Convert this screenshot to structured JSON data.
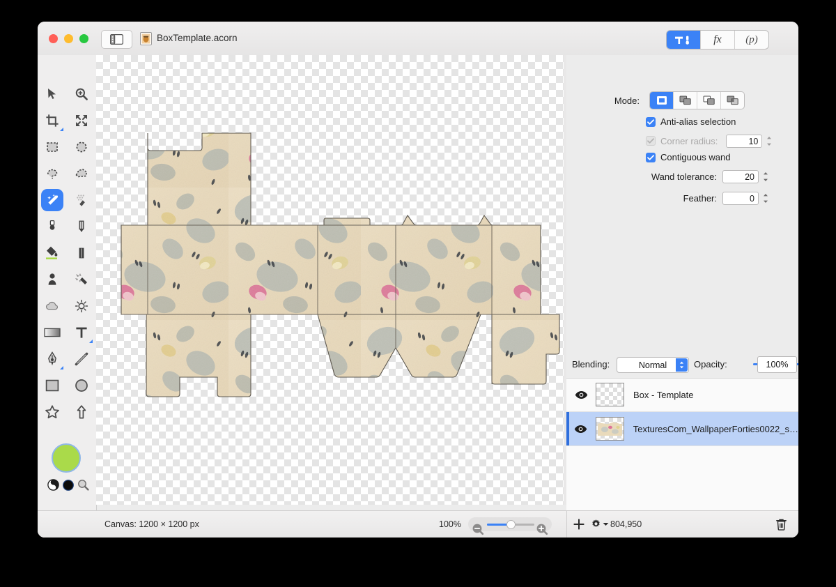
{
  "window": {
    "title": "BoxTemplate.acorn",
    "traffic_lights": [
      "close",
      "minimize",
      "zoom"
    ],
    "sidebar_toggle": "sidebar-toggle",
    "doc_icon": "acorn-document-icon"
  },
  "titlebar_segments": [
    {
      "id": "tools",
      "icon": "hammer-icon",
      "label": "",
      "active": true
    },
    {
      "id": "filters",
      "icon": "fx-icon",
      "label": "fx",
      "active": false
    },
    {
      "id": "presets",
      "icon": "palette-icon",
      "label": "(p)",
      "active": false
    }
  ],
  "tools": [
    {
      "name": "move-tool",
      "icon": "arrow-pointer-icon",
      "selected": false
    },
    {
      "name": "zoom-tool",
      "icon": "magnifier-plus-icon",
      "selected": false
    },
    {
      "name": "crop-tool",
      "icon": "crop-icon",
      "selected": false,
      "submenu": true
    },
    {
      "name": "transform-tool",
      "icon": "arrows-expand-icon",
      "selected": false
    },
    {
      "name": "rectangular-marquee-tool",
      "icon": "dashed-rectangle-icon",
      "selected": false
    },
    {
      "name": "elliptical-marquee-tool",
      "icon": "dashed-ellipse-icon",
      "selected": false
    },
    {
      "name": "lasso-tool",
      "icon": "lasso-icon",
      "selected": false
    },
    {
      "name": "polygon-lasso-tool",
      "icon": "polygon-lasso-icon",
      "selected": false
    },
    {
      "name": "magic-wand-tool",
      "icon": "magic-wand-icon",
      "selected": true
    },
    {
      "name": "instant-alpha-tool",
      "icon": "dotted-wand-icon",
      "selected": false
    },
    {
      "name": "brush-tool",
      "icon": "paintbrush-icon",
      "selected": false
    },
    {
      "name": "pencil-tool",
      "icon": "pencil-icon",
      "selected": false
    },
    {
      "name": "paint-bucket-tool",
      "icon": "paint-bucket-icon",
      "selected": false
    },
    {
      "name": "eraser-tool",
      "icon": "eraser-icon",
      "selected": false
    },
    {
      "name": "clone-stamp-tool",
      "icon": "clone-stamp-icon",
      "selected": false
    },
    {
      "name": "smudge-tool",
      "icon": "smudge-icon",
      "selected": false
    },
    {
      "name": "blur-tool",
      "icon": "cloud-icon",
      "selected": false
    },
    {
      "name": "dodge-tool",
      "icon": "sun-icon",
      "selected": false
    },
    {
      "name": "gradient-tool",
      "icon": "gradient-icon",
      "selected": false
    },
    {
      "name": "text-tool",
      "icon": "text-t-icon",
      "selected": false,
      "submenu": true
    },
    {
      "name": "bezier-pen-tool",
      "icon": "pen-nib-icon",
      "selected": false,
      "submenu": true
    },
    {
      "name": "line-tool",
      "icon": "line-icon",
      "selected": false
    },
    {
      "name": "rectangle-shape-tool",
      "icon": "rectangle-icon",
      "selected": false
    },
    {
      "name": "ellipse-shape-tool",
      "icon": "ellipse-icon",
      "selected": false
    },
    {
      "name": "star-shape-tool",
      "icon": "star-icon",
      "selected": false
    },
    {
      "name": "arrow-shape-tool",
      "icon": "arrow-up-icon",
      "selected": false
    }
  ],
  "palette": {
    "color_swatch": "#aada4a",
    "swatch_ring": "#8fb7e8",
    "mini_icons": [
      "contrast-half-circle-icon",
      "black-circle-icon",
      "magnifier-icon"
    ]
  },
  "inspector": {
    "mode_label": "Mode:",
    "mode_options": [
      {
        "name": "new-selection",
        "active": true
      },
      {
        "name": "add-to-selection",
        "active": false
      },
      {
        "name": "subtract-from-selection",
        "active": false
      },
      {
        "name": "intersect-selection",
        "active": false
      }
    ],
    "antialias": {
      "label": "Anti-alias selection",
      "checked": true,
      "enabled": true
    },
    "corner_radius": {
      "label": "Corner radius:",
      "checked": true,
      "enabled": false,
      "value": "10"
    },
    "contiguous": {
      "label": "Contiguous wand",
      "checked": true,
      "enabled": true
    },
    "wand_tolerance": {
      "label": "Wand tolerance:",
      "value": "20"
    },
    "feather": {
      "label": "Feather:",
      "value": "0"
    }
  },
  "layers_panel": {
    "blending_label": "Blending:",
    "blending_value": "Normal",
    "opacity_label": "Opacity:",
    "opacity_value": "100%",
    "opacity_percent": 100,
    "rows": [
      {
        "name": "Box - Template",
        "visible": true,
        "selected": false,
        "thumb": "checkerboard"
      },
      {
        "name": "TexturesCom_WallpaperForties0022_s…",
        "visible": true,
        "selected": true,
        "thumb": "floral"
      }
    ]
  },
  "status_bar": {
    "canvas_label": "Canvas: 1200 × 1200 px",
    "zoom_label": "100%",
    "zoom_percent": 100,
    "memory": "804,950",
    "icons": [
      "zoom-out-icon",
      "zoom-in-icon",
      "add-layer-icon",
      "layer-actions-gear-icon",
      "delete-layer-trash-icon"
    ]
  },
  "canvas": {
    "name": "document-canvas",
    "background": "transparency-checkerboard",
    "artwork": "floral-box-dieline-template"
  },
  "colors": {
    "accent": "#3b82f6",
    "selection_row": "#bcd2f7",
    "window_chrome": "#ececec"
  }
}
